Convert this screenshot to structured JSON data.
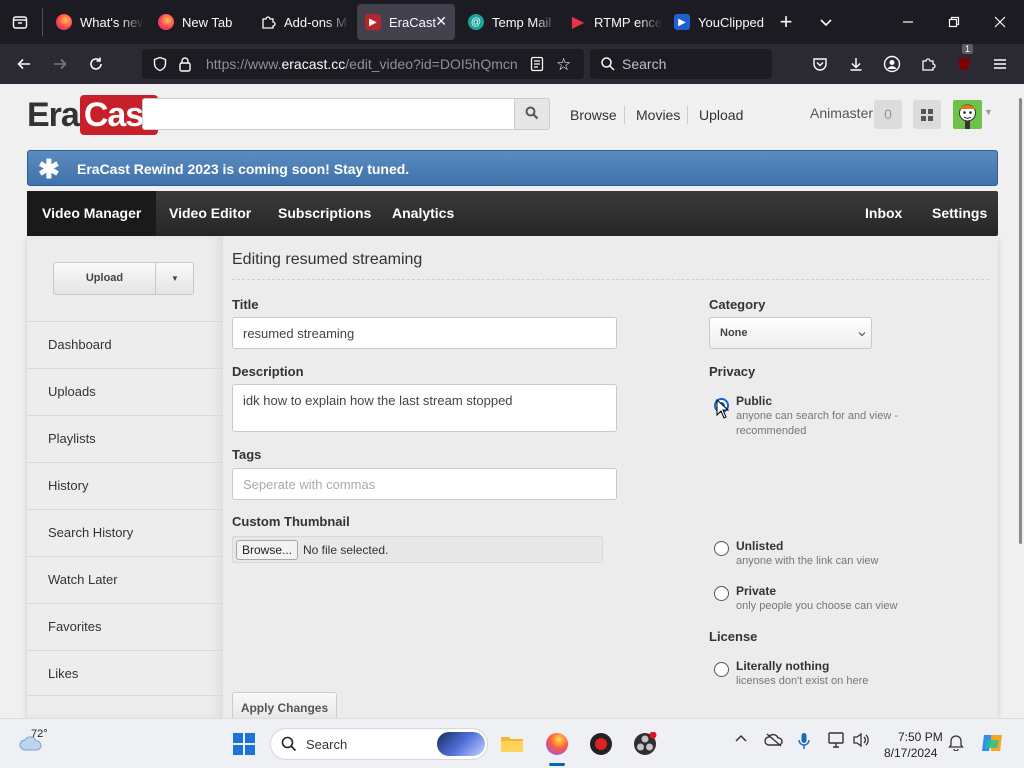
{
  "browser": {
    "tabs": [
      {
        "label": "What's new",
        "active": false
      },
      {
        "label": "New Tab",
        "active": false
      },
      {
        "label": "Add-ons M",
        "active": false
      },
      {
        "label": "EraCast",
        "active": true
      },
      {
        "label": "Temp Mail",
        "active": false
      },
      {
        "label": "RTMP ence",
        "active": false
      },
      {
        "label": "YouClipped",
        "active": false
      }
    ],
    "url_prefix": "https://www.",
    "url_host": "eracast.cc",
    "url_path": "/edit_video?id=DOI5hQmcn",
    "search_placeholder": "Search",
    "extension_badge": "1"
  },
  "site": {
    "logo_era": "Era",
    "logo_cast": "Cast",
    "search_value": "",
    "links": [
      "Browse",
      "Movies",
      "Upload"
    ],
    "username": "Animaster",
    "notification_count": "0"
  },
  "banner": {
    "text": "EraCast Rewind 2023 is coming soon! Stay tuned."
  },
  "main_nav": {
    "items": [
      {
        "label": "Video Manager",
        "active": true
      },
      {
        "label": "Video Editor",
        "active": false
      },
      {
        "label": "Subscriptions",
        "active": false
      },
      {
        "label": "Analytics",
        "active": false
      }
    ],
    "right_items": [
      "Inbox",
      "Settings"
    ]
  },
  "sidebar": {
    "upload_label": "Upload",
    "items": [
      "Dashboard",
      "Uploads",
      "Playlists",
      "History",
      "Search History",
      "Watch Later",
      "Favorites",
      "Likes"
    ]
  },
  "editor": {
    "heading": "Editing resumed streaming",
    "title_label": "Title",
    "title_value": "resumed streaming",
    "description_label": "Description",
    "description_value": "idk how to explain how the last stream stopped",
    "tags_label": "Tags",
    "tags_placeholder": "Seperate with commas",
    "thumbnail_label": "Custom Thumbnail",
    "browse_label": "Browse...",
    "file_status": "No file selected.",
    "apply_label": "Apply Changes",
    "category_label": "Category",
    "category_value": "None",
    "privacy_label": "Privacy",
    "privacy_options": [
      {
        "title": "Public",
        "desc": "anyone can search for and view - recommended",
        "checked": true
      },
      {
        "title": "Unlisted",
        "desc": "anyone with the link can view",
        "checked": false
      },
      {
        "title": "Private",
        "desc": "only people you choose can view",
        "checked": false
      }
    ],
    "license_label": "License",
    "license_options": [
      {
        "title": "Literally nothing",
        "desc": "licenses don't exist on here",
        "checked": false
      }
    ]
  },
  "taskbar": {
    "weather_temp": "72°",
    "search_placeholder": "Search",
    "time": "7:50 PM",
    "date": "8/17/2024"
  },
  "colors": {
    "banner": "#4a7db5",
    "nav_dark": "#2e2e2e",
    "radio_checked": "#0b65d6",
    "logo_red": "#c8202a"
  }
}
